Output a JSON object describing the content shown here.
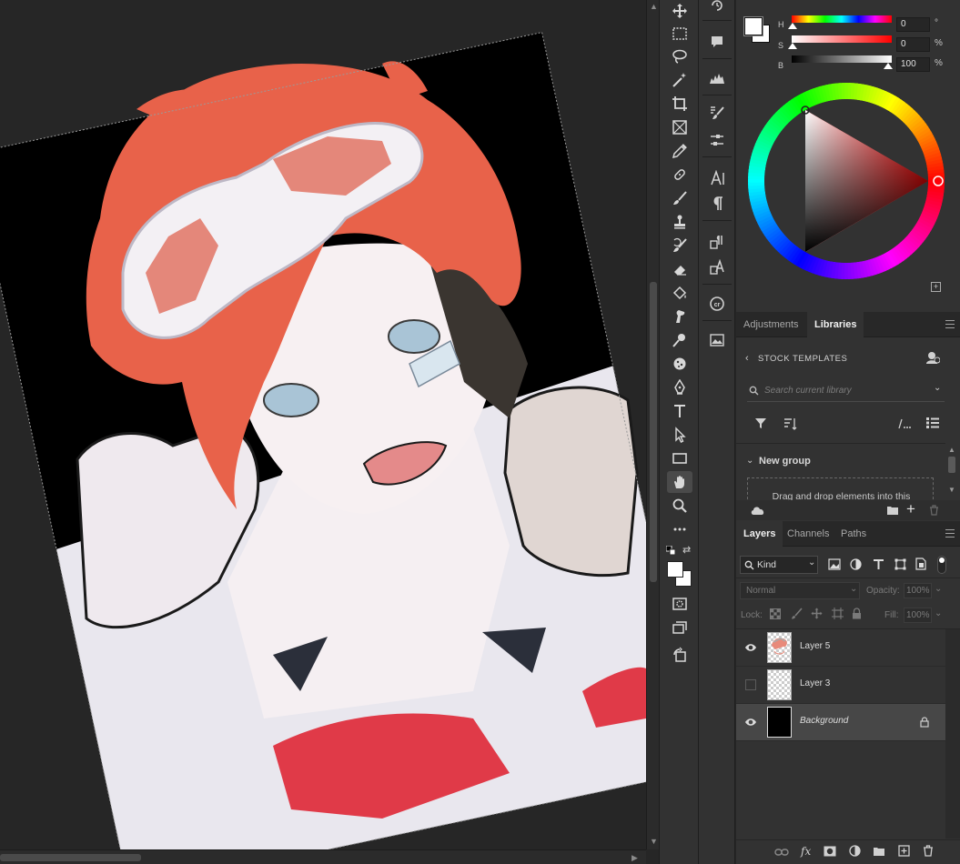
{
  "color_picker": {
    "h_label": "H",
    "h_value": "0",
    "h_unit": "°",
    "s_label": "S",
    "s_value": "0",
    "s_unit": "%",
    "b_label": "B",
    "b_value": "100",
    "b_unit": "%",
    "hue_level": 0,
    "saturation_level": 0,
    "brightness_level": 100,
    "foreground_color": "#ffffff",
    "background_color": "#ffffff"
  },
  "upper_tabs": [
    {
      "label": "Adjustments",
      "active": false
    },
    {
      "label": "Libraries",
      "active": true
    }
  ],
  "libraries": {
    "header": "STOCK TEMPLATES",
    "search_placeholder": "Search current library",
    "group_title": "New group",
    "drop_text": "Drag and drop elements into this"
  },
  "layers_tabs": [
    {
      "label": "Layers",
      "active": true
    },
    {
      "label": "Channels",
      "active": false
    },
    {
      "label": "Paths",
      "active": false
    }
  ],
  "layers_panel": {
    "filter_kind": "Kind",
    "blend_mode": "Normal",
    "opacity_label": "Opacity:",
    "opacity_value": "100%",
    "lock_label": "Lock:",
    "fill_label": "Fill:",
    "fill_value": "100%"
  },
  "layers": [
    {
      "name": "Layer 5",
      "visible": true,
      "selected": false,
      "locked": false,
      "italic": false
    },
    {
      "name": "Layer 3",
      "visible": false,
      "selected": false,
      "locked": false,
      "italic": false
    },
    {
      "name": "Background",
      "visible": true,
      "selected": true,
      "locked": true,
      "italic": true
    }
  ],
  "colors": {
    "panel_bg": "#323232",
    "canvas_bg": "#262626",
    "selected_layer": "#474747",
    "hair": "#e8624a",
    "artwork_bg": "#000000"
  },
  "tools": [
    "move-tool",
    "marquee-tool",
    "lasso-tool",
    "magic-wand-tool",
    "crop-tool",
    "frame-tool",
    "eyedropper-tool",
    "healing-brush-tool",
    "brush-tool",
    "clone-stamp-tool",
    "history-brush-tool",
    "eraser-tool",
    "paint-bucket-tool",
    "smudge-tool",
    "dodge-tool",
    "sponge-tool",
    "pen-tool",
    "type-tool",
    "path-selection-tool",
    "rectangle-tool",
    "hand-tool",
    "zoom-tool",
    "more-tools"
  ]
}
